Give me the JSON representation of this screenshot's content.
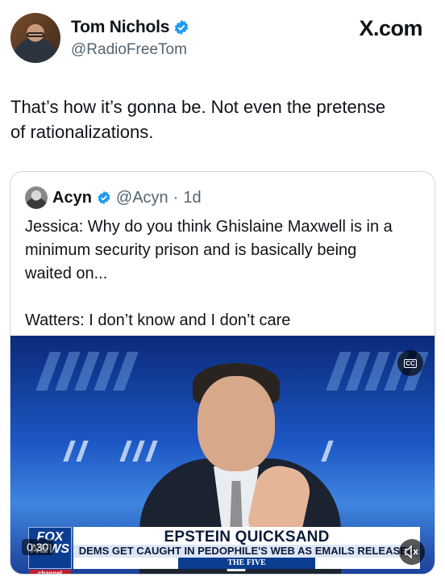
{
  "author": {
    "display_name": "Tom Nichols",
    "handle": "@RadioFreeTom",
    "verified_icon": "verified-badge-icon"
  },
  "source_watermark": "X.com",
  "tweet": {
    "text": "That’s how it’s gonna be. Not even the pretense\nof rationalizations."
  },
  "quoted_tweet": {
    "display_name": "Acyn",
    "handle": "@Acyn",
    "separator": "·",
    "age": "1d",
    "text": "Jessica: Why do you think Ghislaine Maxwell is in a\nminimum security prison and is basically being\nwaited on...\n\nWatters: I don’t know and I don’t care",
    "video": {
      "timecode": "0:30",
      "cc_label": "CC",
      "mute_icon": "volume-muted-icon",
      "network_logo": "FOX NEWS",
      "network_sub": "channel",
      "headline": "EPSTEIN QUICKSAND",
      "subheadline": "DEMS GET CAUGHT IN PEDOPHILE'S WEB AS EMAILS RELEASED",
      "show_name": "THE FIVE"
    }
  },
  "colors": {
    "verified_blue": "#1d9bf0",
    "secondary_text": "#536471",
    "border": "#cfd9de"
  }
}
